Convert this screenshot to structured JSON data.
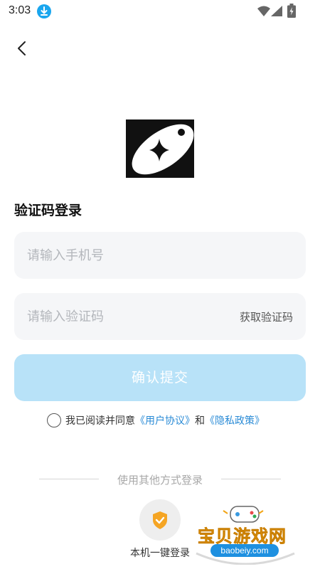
{
  "status_bar": {
    "time": "3:03"
  },
  "form": {
    "title": "验证码登录",
    "phone_placeholder": "请输入手机号",
    "code_placeholder": "请输入验证码",
    "get_code_label": "获取验证码",
    "submit_label": "确认提交"
  },
  "agreement": {
    "prefix": "我已阅读并同意",
    "user_agreement": "《用户协议》",
    "conjunction": "和",
    "privacy_policy": "《隐私政策》"
  },
  "other_login": {
    "divider_text": "使用其他方式登录",
    "one_key_label": "本机一键登录"
  },
  "watermark": {
    "title": "宝贝游戏网",
    "url": "baobeiy.com"
  },
  "colors": {
    "accent": "#2a8bd6",
    "submit_disabled": "#b8e2f8",
    "field_bg": "#f5f6f8",
    "shield_orange": "#f5a524"
  }
}
